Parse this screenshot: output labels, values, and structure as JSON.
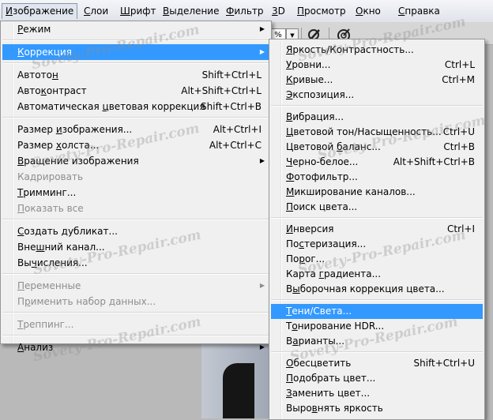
{
  "menubar": [
    {
      "label": "Изображение",
      "underline": "И",
      "active": true
    },
    {
      "label": "Слои",
      "underline": "С",
      "active": false
    },
    {
      "label": "Шрифт",
      "underline": "Ш",
      "active": false
    },
    {
      "label": "Выделение",
      "underline": "В",
      "active": false
    },
    {
      "label": "Фильтр",
      "underline": "Ф",
      "active": false
    },
    {
      "label": "3D",
      "underline": "3",
      "active": false
    },
    {
      "label": "Просмотр",
      "underline": "П",
      "active": false
    },
    {
      "label": "Окно",
      "underline": "О",
      "active": false
    },
    {
      "label": "Справка",
      "underline": "С",
      "active": false
    }
  ],
  "toolbar": {
    "zoom_value": "%",
    "dropdown_icon": "chevron-down-icon"
  },
  "image_menu": [
    {
      "type": "item",
      "label": "Режим",
      "underline": "Р",
      "submenu": true
    },
    {
      "type": "sep"
    },
    {
      "type": "item",
      "label": "Коррекция",
      "underline": "К",
      "submenu": true,
      "highlighted": true
    },
    {
      "type": "sep"
    },
    {
      "type": "item",
      "label": "Автотон",
      "underline": "н",
      "shortcut": "Shift+Ctrl+L"
    },
    {
      "type": "item",
      "label": "Автоконтраст",
      "underline": "к",
      "shortcut": "Alt+Shift+Ctrl+L"
    },
    {
      "type": "item",
      "label": "Автоматическая цветовая коррекция",
      "underline": "ц",
      "shortcut": "Shift+Ctrl+B"
    },
    {
      "type": "sep"
    },
    {
      "type": "item",
      "label": "Размер изображения...",
      "underline": "и",
      "shortcut": "Alt+Ctrl+I"
    },
    {
      "type": "item",
      "label": "Размер холста...",
      "underline": "х",
      "shortcut": "Alt+Ctrl+C"
    },
    {
      "type": "item",
      "label": "Вращение изображения",
      "underline": "В",
      "submenu": true
    },
    {
      "type": "item",
      "label": "Кадрировать",
      "underline": "д",
      "disabled": true
    },
    {
      "type": "item",
      "label": "Тримминг...",
      "underline": "Т"
    },
    {
      "type": "item",
      "label": "Показать все",
      "underline": "П",
      "disabled": true
    },
    {
      "type": "sep"
    },
    {
      "type": "item",
      "label": "Создать дубликат...",
      "underline": "С"
    },
    {
      "type": "item",
      "label": "Внешний канал...",
      "underline": "ш"
    },
    {
      "type": "item",
      "label": "Вычисления...",
      "underline": "ч"
    },
    {
      "type": "sep"
    },
    {
      "type": "item",
      "label": "Переменные",
      "underline": "П",
      "submenu": true,
      "disabled": true
    },
    {
      "type": "item",
      "label": "Применить набор данных...",
      "underline": "р",
      "disabled": true
    },
    {
      "type": "sep"
    },
    {
      "type": "item",
      "label": "Треппинг...",
      "underline": "Т",
      "disabled": true
    },
    {
      "type": "sep"
    },
    {
      "type": "item",
      "label": "Анализ",
      "underline": "А",
      "submenu": true
    }
  ],
  "adjustments_menu": [
    {
      "type": "item",
      "label": "Яркость/Контрастность...",
      "underline": "Я"
    },
    {
      "type": "item",
      "label": "Уровни...",
      "underline": "У",
      "shortcut": "Ctrl+L"
    },
    {
      "type": "item",
      "label": "Кривые...",
      "underline": "К",
      "shortcut": "Ctrl+M"
    },
    {
      "type": "item",
      "label": "Экспозиция...",
      "underline": "Э"
    },
    {
      "type": "sep"
    },
    {
      "type": "item",
      "label": "Вибрация...",
      "underline": "В"
    },
    {
      "type": "item",
      "label": "Цветовой тон/Насыщенность...",
      "underline": "Ц",
      "shortcut": "Ctrl+U"
    },
    {
      "type": "item",
      "label": "Цветовой баланс...",
      "underline": "б",
      "shortcut": "Ctrl+B"
    },
    {
      "type": "item",
      "label": "Черно-белое...",
      "underline": "Ч",
      "shortcut": "Alt+Shift+Ctrl+B"
    },
    {
      "type": "item",
      "label": "Фотофильтр...",
      "underline": "Ф"
    },
    {
      "type": "item",
      "label": "Микширование каналов...",
      "underline": "М"
    },
    {
      "type": "item",
      "label": "Поиск цвета...",
      "underline": "П"
    },
    {
      "type": "sep"
    },
    {
      "type": "item",
      "label": "Инверсия",
      "underline": "И",
      "shortcut": "Ctrl+I"
    },
    {
      "type": "item",
      "label": "Постеризация...",
      "underline": "с"
    },
    {
      "type": "item",
      "label": "Порог...",
      "underline": "р"
    },
    {
      "type": "item",
      "label": "Карта градиента...",
      "underline": "г"
    },
    {
      "type": "item",
      "label": "Выборочная коррекция цвета...",
      "underline": "ы"
    },
    {
      "type": "sep"
    },
    {
      "type": "item",
      "label": "Тени/Света...",
      "underline": "Т",
      "highlighted": true
    },
    {
      "type": "item",
      "label": "Тонирование HDR...",
      "underline": "о"
    },
    {
      "type": "item",
      "label": "Варианты...",
      "underline": "а"
    },
    {
      "type": "sep"
    },
    {
      "type": "item",
      "label": "Обесцветить",
      "underline": "О",
      "shortcut": "Shift+Ctrl+U"
    },
    {
      "type": "item",
      "label": "Подобрать цвет...",
      "underline": "П"
    },
    {
      "type": "item",
      "label": "Заменить цвет...",
      "underline": "З"
    },
    {
      "type": "item",
      "label": "Выровнять яркость",
      "underline": "в"
    }
  ],
  "watermark": "Sovety-Pro-Repair.com",
  "colors": {
    "highlight": "#3399ff",
    "menu_bg": "#f0f0f0",
    "disabled_text": "#8d8d8d"
  }
}
